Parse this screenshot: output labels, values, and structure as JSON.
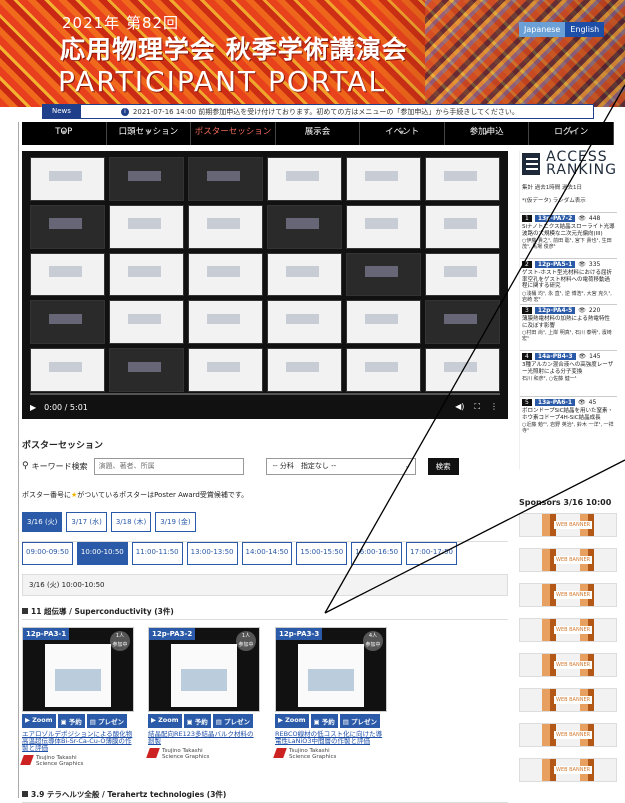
{
  "header": {
    "line1": "2021年 第82回",
    "line2": "応用物理学会 秋季学術講演会",
    "line3": "PARTICIPANT PORTAL",
    "lang": [
      "Japanese",
      "English"
    ]
  },
  "news": {
    "tag": "News",
    "text": "2021-07-16 14:00 前期参加申込を受け付けております。初めての方はメニューの「参加申込」から手続きしてください。"
  },
  "nav": [
    "TOP",
    "口頭セッション",
    "ポスターセッション",
    "展示会",
    "イベント",
    "参加申込",
    "ログイン"
  ],
  "video": {
    "time": "0:00 / 5:01"
  },
  "poster": {
    "title": "ポスターセッション",
    "search_label": "キーワード検索",
    "search_placeholder": "演題、著者、所属",
    "select": "-- 分科　指定なし --",
    "search_button": "検索",
    "award_a": "ポスター番号に",
    "award_b": "がついているポスターはPoster Award受賞候補です。",
    "days": [
      "3/16 (火)",
      "3/17 (水)",
      "3/18 (木)",
      "3/19 (金)"
    ],
    "times": [
      "09:00-09:50",
      "10:00-10:50",
      "11:00-11:50",
      "13:00-13:50",
      "14:00-14:50",
      "15:00-15:50",
      "16:00-16:50",
      "17:00-17:50"
    ],
    "slot": "3/16 (火) 10:00-10:50",
    "cat1": "11 超伝導 / Superconductivity (3件)",
    "cat2": "3.9 テラヘルツ全般 / Terahertz technologies (3件)",
    "btns": [
      "Zoom",
      "予約",
      "プレゼン"
    ],
    "cards": [
      {
        "id": "12p-PA3-1",
        "view": "1人",
        "view2": "参加中",
        "title": "エアロゾルデポジションによる酸化物高温超伝導体Bi-Sr-Ca-Cu-O薄膜の作製と評価",
        "author": "Tsujino Takashi",
        "org": "Science Graphics"
      },
      {
        "id": "12p-PA3-2",
        "view": "1人",
        "view2": "参加中",
        "title": "結晶配向RE123多結晶バルク材料の創製",
        "author": "Tsujino Takashi",
        "org": "Science Graphics"
      },
      {
        "id": "12p-PA3-3",
        "view": "4人",
        "view2": "参加中",
        "title": "REBCO線材の低コスト化に向けた導電性LaNiO3中間層の作製と評価",
        "author": "Tsujino Takashi",
        "org": "Science Graphics"
      }
    ]
  },
  "side": {
    "logo1": "ACCESS",
    "logo2": "RANKING",
    "meta": "集計 過去1時間 過去1日",
    "note": "*(仮データ) ランダム表示",
    "ranks": [
      {
        "n": "1",
        "id": "13p-PA7-2",
        "c": "448",
        "t": "Siナノトニクス結晶スローライト光導波路の大規模な二次元光偏向(III)",
        "a": "○伊藤 貴之¹, 前田 聡¹, 宮下 貴也¹, 生田 茂¹, 馬場 俊彦¹"
      },
      {
        "n": "2",
        "id": "12p-PA5-1",
        "c": "335",
        "t": "ゲスト-ホスト型光材料における屈折率空孔をゲスト材料への電荷移動過程に関する研究",
        "a": "○浅桶 均¹, 永 直¹, 逆 博浩², 大宮 克久¹, 岩崎 宏²"
      },
      {
        "n": "3",
        "id": "12p-PA4-5",
        "c": "220",
        "t": "薄膜熱電材料の加熱による熱電特性に及ぼす影響",
        "a": "○村田 尚¹, 上岸 明真¹, 石川 泰明¹, 濱崎 宏¹"
      },
      {
        "n": "4",
        "id": "14a-PB4-3",
        "c": "145",
        "t": "3種アルカン混合液への高強度レーザー光照射による分子変換",
        "a": "石川 和彦², ○佐藤 健一¹"
      },
      {
        "n": "5",
        "id": "13a-PA6-1",
        "c": "45",
        "t": "ボロンドープSiC結晶を用いた窒素・ホウ素コドープ4H-SiC結晶成長",
        "a": "○近藤 勉²¹, 岩野 英治¹, 鈴木 一洋¹, 一祥 寺¹"
      }
    ]
  },
  "sponsors": {
    "title": "Sponsors 3/16 10:00",
    "banner": "WEB BANNER"
  }
}
